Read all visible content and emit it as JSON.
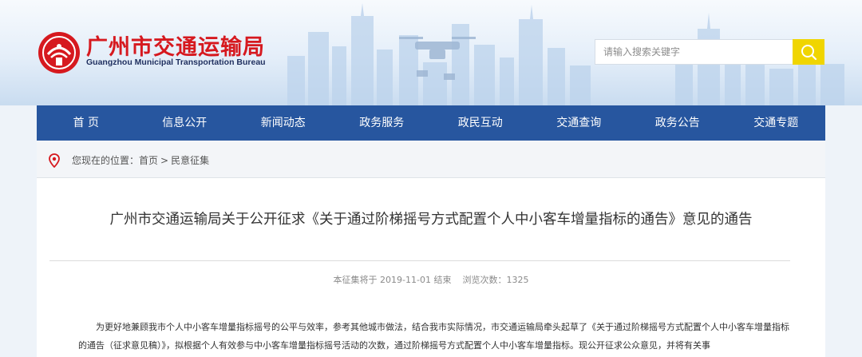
{
  "site": {
    "name_cn": "广州市交通运输局",
    "name_en": "Guangzhou Municipal Transportation Bureau"
  },
  "search": {
    "placeholder": "请输入搜索关键字"
  },
  "nav": {
    "items": [
      {
        "label": "首 页"
      },
      {
        "label": "信息公开"
      },
      {
        "label": "新闻动态"
      },
      {
        "label": "政务服务"
      },
      {
        "label": "政民互动"
      },
      {
        "label": "交通查询"
      },
      {
        "label": "政务公告"
      },
      {
        "label": "交通专题"
      }
    ]
  },
  "breadcrumb": {
    "prefix": "您现在的位置：",
    "home": "首页",
    "separator": ">",
    "current": "民意征集"
  },
  "article": {
    "title": "广州市交通运输局关于公开征求《关于通过阶梯摇号方式配置个人中小客车增量指标的通告》意见的通告",
    "deadline": "本征集将于 2019-11-01 结束",
    "views": "浏览次数：1325",
    "body": "为更好地兼顾我市个人中小客车增量指标摇号的公平与效率，参考其他城市做法，结合我市实际情况，市交通运输局牵头起草了《关于通过阶梯摇号方式配置个人中小客车增量指标的通告（征求意见稿）》，拟根据个人有效参与中小客车增量指标摇号活动的次数，通过阶梯摇号方式配置个人中小客车增量指标。现公开征求公众意见，并将有关事"
  },
  "colors": {
    "nav_bg": "#27569f",
    "brand_red": "#d6191f",
    "search_button": "#f0d500"
  },
  "icons": {
    "search": "magnifier-icon",
    "location": "location-pin-icon",
    "logo": "bureau-emblem-icon"
  }
}
